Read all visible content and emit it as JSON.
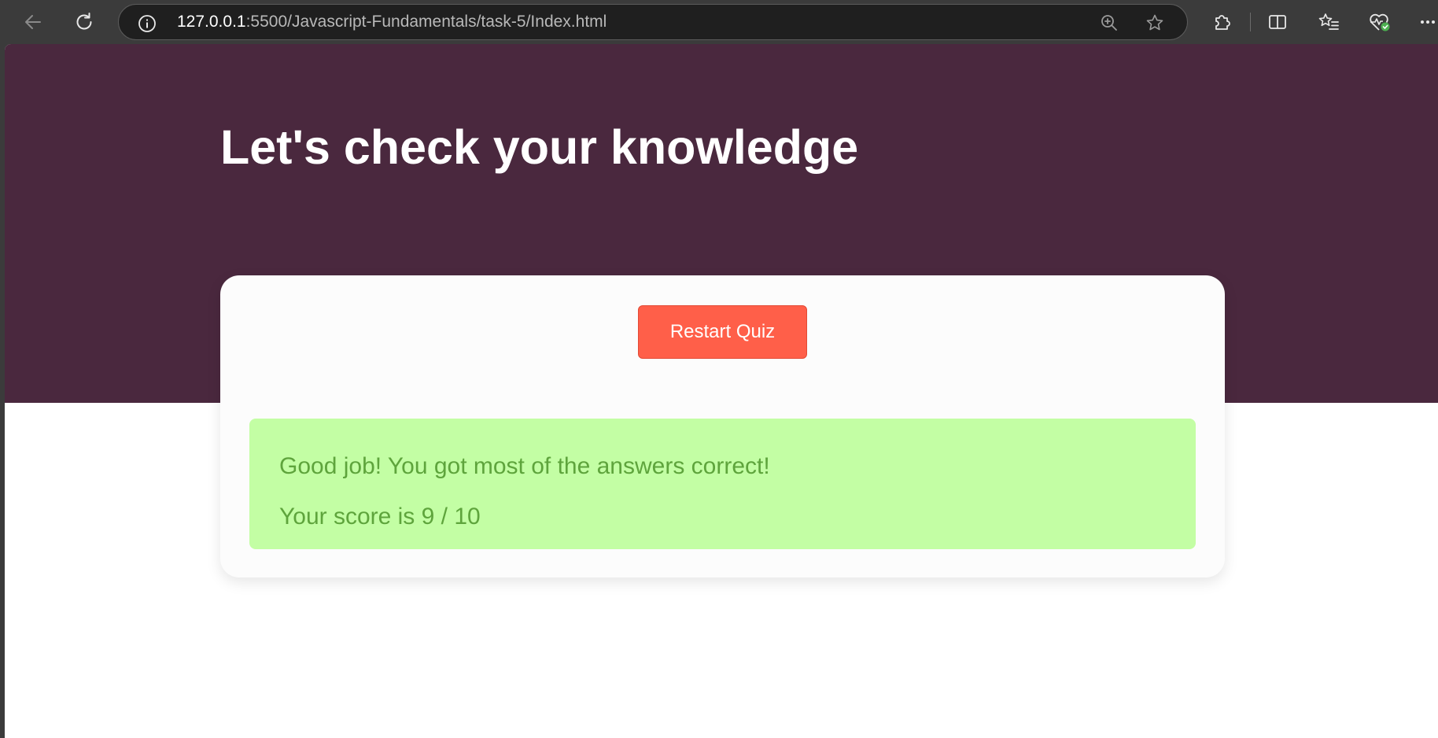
{
  "browser": {
    "url_host": "127.0.0.1",
    "url_rest": ":5500/Javascript-Fundamentals/task-5/Index.html",
    "icons": {
      "back": "back-arrow-icon",
      "reload": "reload-icon",
      "info": "info-icon",
      "zoom": "zoom-in-icon",
      "favorite": "star-icon",
      "extensions": "puzzle-icon",
      "split_screen": "split-screen-icon",
      "favorites": "favorites-list-icon",
      "browser_essentials": "heart-pulse-icon",
      "menu": "more-icon"
    }
  },
  "page": {
    "title": "Let's check your knowledge",
    "restart_label": "Restart Quiz",
    "result_message": "Good job! You got most of the answers correct!",
    "result_score": "Your score is 9 / 10"
  },
  "colors": {
    "hero_bg": "#4a283e",
    "button_bg": "#ff5f49",
    "result_bg": "#c3fea4",
    "result_text": "#5ea43c"
  }
}
